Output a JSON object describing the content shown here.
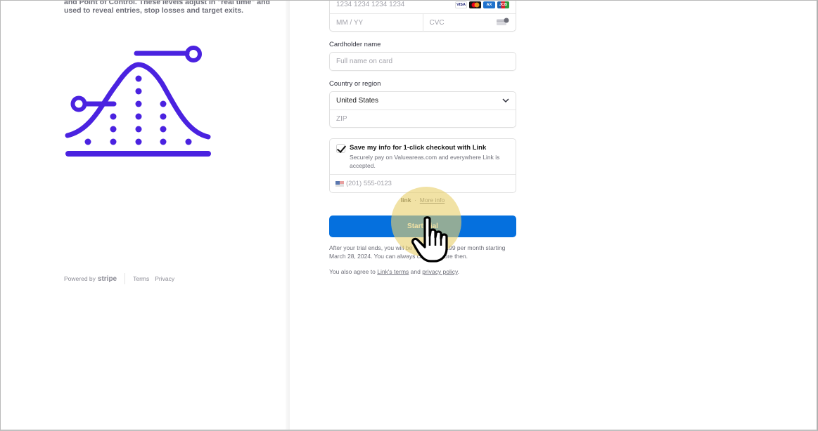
{
  "left": {
    "description_lines": [
      "and Point of Control. These levels adjust in \"real time\" and",
      "used to reveal entries, stop losses and target exits."
    ],
    "illustration_icon": "bell-curve-distribution-icon",
    "accent_color": "#4a22e0",
    "footer": {
      "powered_by": "Powered by",
      "brand": "stripe",
      "terms": "Terms",
      "privacy": "Privacy"
    }
  },
  "form": {
    "card_number_placeholder": "1234 1234 1234 1234",
    "card_brands": [
      "VISA",
      "Mastercard",
      "Amex",
      "JCB"
    ],
    "expiry_placeholder": "MM / YY",
    "cvc_placeholder": "CVC",
    "cardholder_label": "Cardholder name",
    "cardholder_placeholder": "Full name on card",
    "country_label": "Country or region",
    "country_value": "United States",
    "zip_placeholder": "ZIP",
    "link_save": {
      "checked": true,
      "title": "Save my info for 1-click checkout with Link",
      "subtitle": "Securely pay on Valueareas.com and everywhere Link is accepted.",
      "phone_placeholder": "(201) 555-0123"
    },
    "link_logo": "link",
    "link_separator": "·",
    "more_info": "More info",
    "submit_label": "Start trial",
    "submit_color": "#0570de",
    "trial_note": "After your trial ends, you will be charged $19.99 per month starting March 28, 2024. You can always cancel before then.",
    "agree_prefix": "You also agree to ",
    "agree_link_terms": "Link's terms",
    "agree_and": " and ",
    "agree_privacy": "privacy policy",
    "agree_suffix": "."
  },
  "cursor": {
    "type": "pointer-hand",
    "highlight_color": "#e8d06e"
  }
}
